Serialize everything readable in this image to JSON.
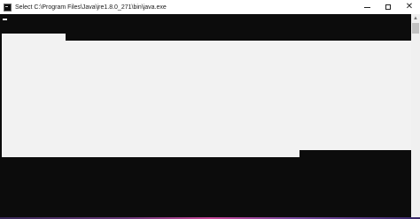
{
  "window": {
    "title": "Select C:\\Program Files\\Java\\jre1.8.0_271\\bin\\java.exe",
    "controls": {
      "minimize_icon": "minimize-icon",
      "maximize_icon": "maximize-icon",
      "close_glyph": "✕"
    }
  },
  "console": {
    "background": "#0c0c0c",
    "selection_color": "#f2f2f2"
  },
  "scrollbar": {
    "up_glyph": "▲"
  }
}
